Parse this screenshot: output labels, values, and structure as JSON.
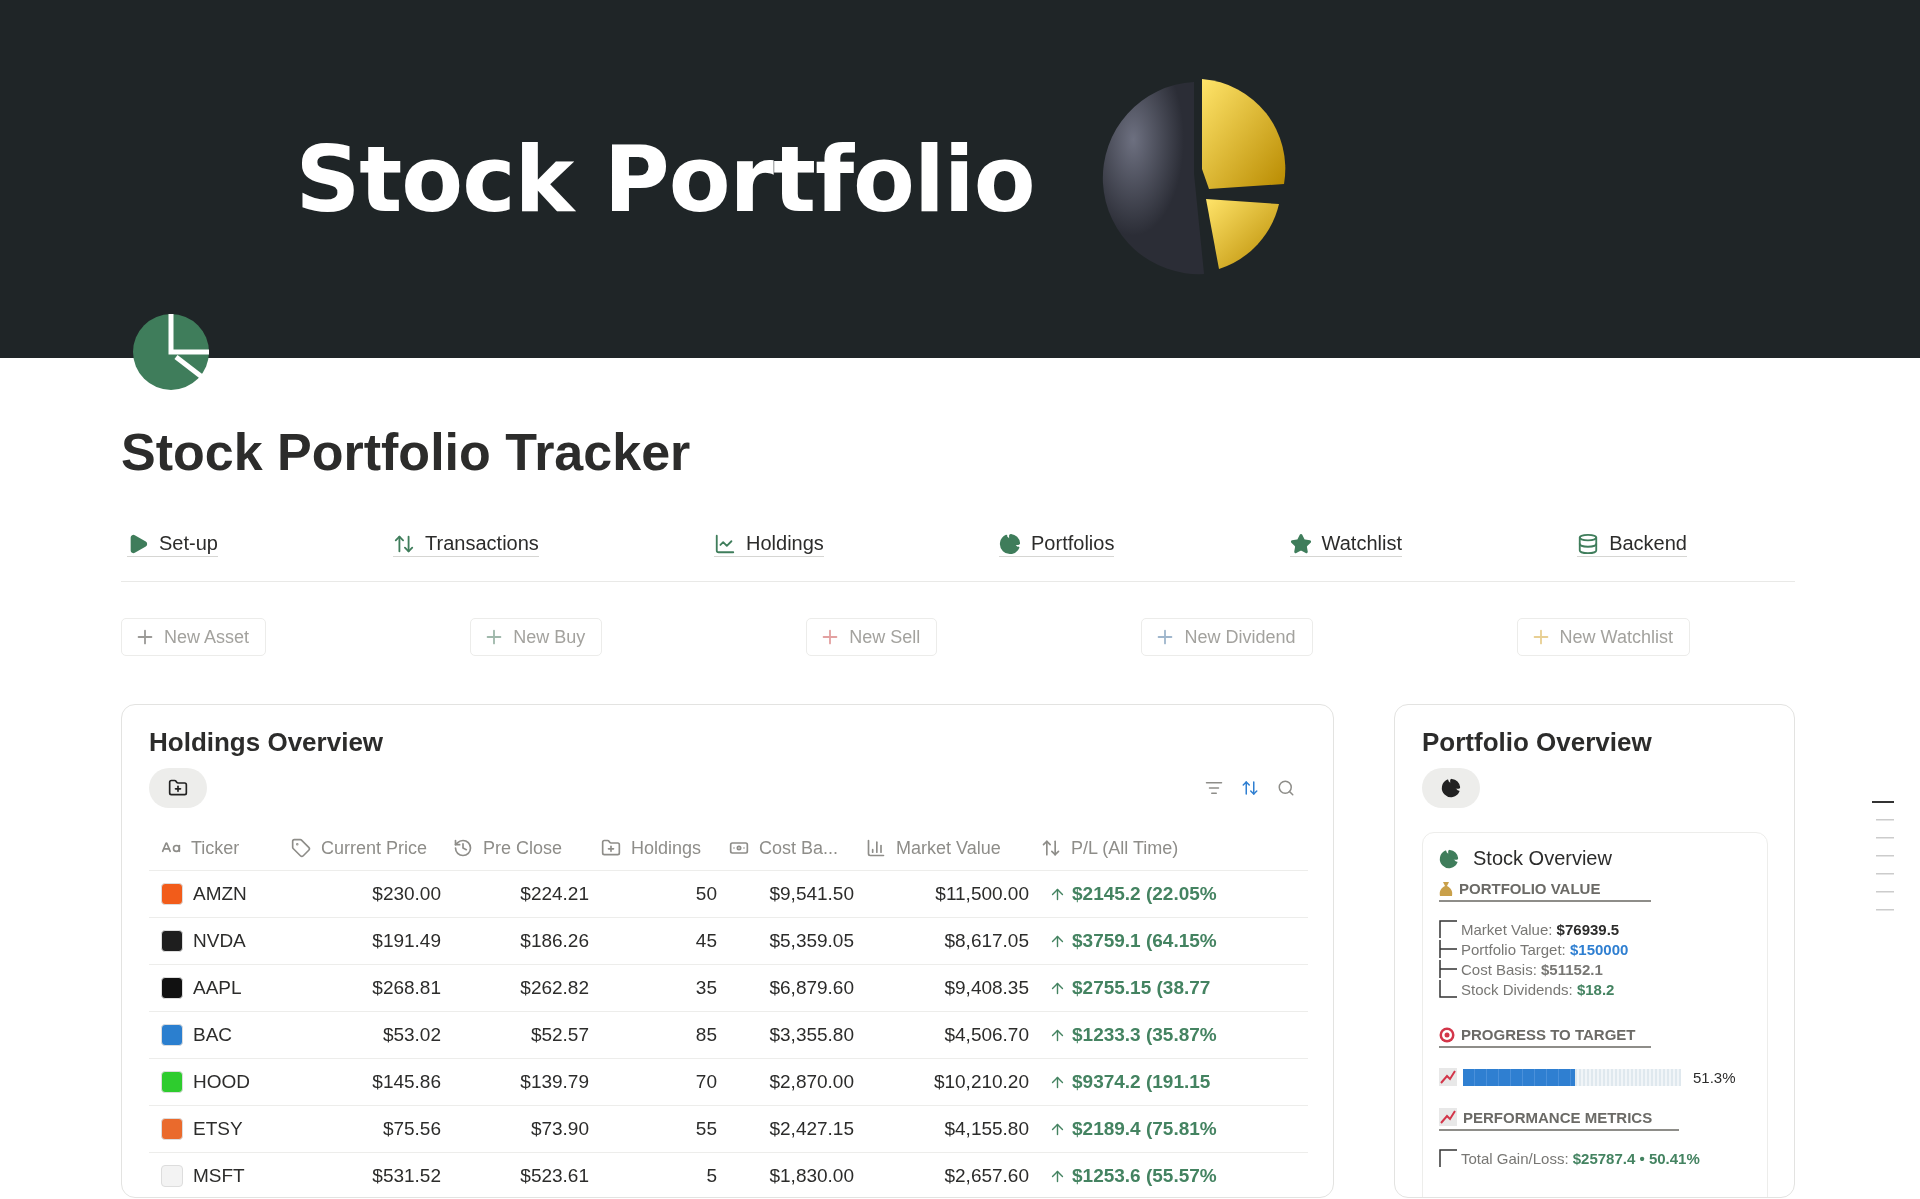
{
  "banner": {
    "title": "Stock Portfolio"
  },
  "page": {
    "title": "Stock Portfolio Tracker"
  },
  "nav": [
    {
      "kind": "play",
      "label": "Set-up"
    },
    {
      "kind": "arrows",
      "label": "Transactions"
    },
    {
      "kind": "chart",
      "label": "Holdings"
    },
    {
      "kind": "pie",
      "label": "Portfolios"
    },
    {
      "kind": "star",
      "label": "Watchlist"
    },
    {
      "kind": "database",
      "label": "Backend"
    }
  ],
  "actions": [
    {
      "label": "New Asset",
      "color": "#9b9a97"
    },
    {
      "label": "New Buy",
      "color": "#9fb8ab"
    },
    {
      "label": "New Sell",
      "color": "#e3a1a1"
    },
    {
      "label": "New Dividend",
      "color": "#9fb6cc"
    },
    {
      "label": "New Watchlist",
      "color": "#e8cf93"
    }
  ],
  "holdings": {
    "title": "Holdings Overview",
    "columns": [
      {
        "kind": "text",
        "label": "Ticker"
      },
      {
        "kind": "tag",
        "label": "Current Price"
      },
      {
        "kind": "history",
        "label": "Pre Close"
      },
      {
        "kind": "folder",
        "label": "Holdings"
      },
      {
        "kind": "money",
        "label": "Cost Ba..."
      },
      {
        "kind": "bars",
        "label": "Market Value"
      },
      {
        "kind": "arrows",
        "label": "P/L (All Time)"
      }
    ],
    "rows": [
      {
        "ticker": "AMZN",
        "color": "#f25c1a",
        "price": "$230.00",
        "pre_close": "$224.21",
        "holdings": "50",
        "cost": "$9,541.50",
        "market": "$11,500.00",
        "pl": "$2145.2 (22.05%"
      },
      {
        "ticker": "NVDA",
        "color": "#1e1e1e",
        "price": "$191.49",
        "pre_close": "$186.26",
        "holdings": "45",
        "cost": "$5,359.05",
        "market": "$8,617.05",
        "pl": "$3759.1 (64.15%"
      },
      {
        "ticker": "AAPL",
        "color": "#111111",
        "price": "$268.81",
        "pre_close": "$262.82",
        "holdings": "35",
        "cost": "$6,879.60",
        "market": "$9,408.35",
        "pl": "$2755.15 (38.77"
      },
      {
        "ticker": "BAC",
        "color": "#2b7fcf",
        "price": "$53.02",
        "pre_close": "$52.57",
        "holdings": "85",
        "cost": "$3,355.80",
        "market": "$4,506.70",
        "pl": "$1233.3 (35.87%"
      },
      {
        "ticker": "HOOD",
        "color": "#2ecc2e",
        "price": "$145.86",
        "pre_close": "$139.79",
        "holdings": "70",
        "cost": "$2,870.00",
        "market": "$10,210.20",
        "pl": "$9374.2 (191.15"
      },
      {
        "ticker": "ETSY",
        "color": "#ea6a2c",
        "price": "$75.56",
        "pre_close": "$73.90",
        "holdings": "55",
        "cost": "$2,427.15",
        "market": "$4,155.80",
        "pl": "$2189.4 (75.81%"
      },
      {
        "ticker": "MSFT",
        "color": "#f3f3f3",
        "price": "$531.52",
        "pre_close": "$523.61",
        "holdings": "5",
        "cost": "$1,830.00",
        "market": "$2,657.60",
        "pl": "$1253.6 (55.57%"
      }
    ]
  },
  "portfolio": {
    "title": "Portfolio Overview",
    "card_title": "Stock Overview",
    "value_heading": "PORTFOLIO VALUE",
    "values": [
      {
        "label": "Market Value:",
        "value": "$76939.5",
        "color": "#2c2c2b"
      },
      {
        "label": "Portfolio Target:",
        "value": "$150000",
        "color": "#2f7fd1"
      },
      {
        "label": "Cost Basis:",
        "value": "$51152.1",
        "color": "#787774"
      },
      {
        "label": "Stock Dividends:",
        "value": "$18.2",
        "color": "#448361"
      }
    ],
    "progress_heading": "PROGRESS TO TARGET",
    "progress": {
      "level": 0.513,
      "reading": "51.3%"
    },
    "metrics_heading": "PERFORMANCE METRICS",
    "metrics": [
      {
        "label": "Total Gain/Loss:",
        "value": "$25787.4 • 50.41%"
      }
    ]
  }
}
